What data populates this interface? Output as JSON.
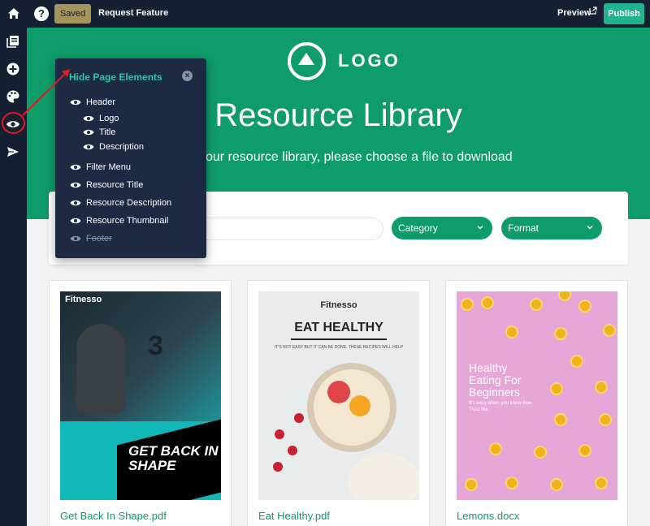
{
  "topbar": {
    "saved_label": "Saved",
    "request_label": "Request Feature",
    "preview_label": "Preview",
    "publish_label": "Publish"
  },
  "sidebar": {
    "icons": [
      "home-icon",
      "library-icon",
      "add-icon",
      "palette-icon",
      "eye-icon",
      "send-icon"
    ]
  },
  "hero": {
    "logo_text": "LOGO",
    "title": "Resource Library",
    "subtitle": "our resource library, please choose a file to download"
  },
  "filters": {
    "category_label": "Category",
    "format_label": "Format"
  },
  "popup": {
    "title": "Hide Page Elements",
    "items": [
      {
        "label": "Header",
        "hidden": false
      },
      {
        "label": "Logo",
        "hidden": false
      },
      {
        "label": "Title",
        "hidden": false
      },
      {
        "label": "Description",
        "hidden": false
      },
      {
        "label": "Filter Menu",
        "hidden": false
      },
      {
        "label": "Resource Title",
        "hidden": false
      },
      {
        "label": "Resource Description",
        "hidden": false
      },
      {
        "label": "Resource Thumbnail",
        "hidden": false
      },
      {
        "label": "Footer",
        "hidden": true
      }
    ]
  },
  "resources": [
    {
      "file": "Get Back In Shape.pdf",
      "thumb": {
        "brand": "Fitnesso",
        "headline": "GET BACK IN SHAPE",
        "number": "3"
      }
    },
    {
      "file": "Eat Healthy.pdf",
      "thumb": {
        "brand": "Fitnesso",
        "headline": "EAT HEALTHY",
        "tagline": "IT'S NOT EASY BUT IT CAN BE DONE. THESE RECIPES WILL HELP"
      }
    },
    {
      "file": "Lemons.docx",
      "thumb": {
        "headline": "Healthy Eating For Beginners",
        "tagline": "It's easy when you know how. Trust Me."
      }
    }
  ],
  "colors": {
    "nav_bg": "#152033",
    "brand_green": "#0e9c68",
    "publish_green": "#21b38e",
    "popup_bg": "#1c2a43",
    "popup_title": "#2cc6a4",
    "annotation_red": "#e01b22"
  }
}
